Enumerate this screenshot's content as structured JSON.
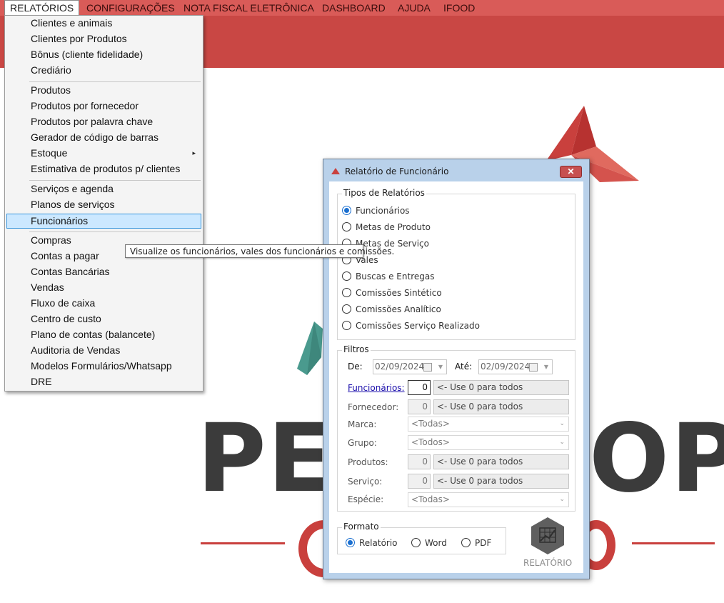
{
  "menubar": {
    "items": [
      "RELATÓRIOS",
      "CONFIGURAÇÕES",
      "NOTA FISCAL ELETRÔNICA",
      "DASHBOARD",
      "AJUDA",
      "IFOOD"
    ]
  },
  "background": {
    "logo_text_left": "PE",
    "logo_text_right": "OP"
  },
  "dropdown": {
    "items": [
      "Clientes e animais",
      "Clientes por Produtos",
      "Bônus (cliente fidelidade)",
      "Crediário",
      "Produtos",
      "Produtos por fornecedor",
      "Produtos por palavra chave",
      "Gerador de código de barras",
      "Estoque",
      "Estimativa de produtos p/ clientes",
      "Serviços e agenda",
      "Planos de serviços",
      "Funcionários",
      "Compras",
      "Contas a pagar",
      "Contas Bancárias",
      "Vendas",
      "Fluxo de caixa",
      "Centro de custo",
      "Plano de contas (balancete)",
      "Auditoria de Vendas",
      "Modelos Formulários/Whatsapp",
      "DRE"
    ],
    "submenu_arrow": "▸",
    "highlighted": "Funcionários"
  },
  "tooltip": {
    "text": "Visualize os funcionários, vales dos funcionários e comissões."
  },
  "dialog": {
    "title": "Relatório de Funcionário",
    "close_label": "✕",
    "tipos": {
      "title": "Tipos de Relatórios",
      "options": [
        "Funcionários",
        "Metas de Produto",
        "Metas de Serviço",
        "Vales",
        "Buscas e Entregas",
        "Comissões Sintético",
        "Comissões Analítico",
        "Comissões Serviço Realizado"
      ],
      "selected": "Funcionários"
    },
    "filtros": {
      "title": "Filtros",
      "de_label": "De:",
      "de_value": "02/09/2024",
      "ate_label": "Até:",
      "ate_value": "02/09/2024",
      "funcionarios_label": "Funcionários:",
      "funcionarios_value": "0",
      "funcionarios_hint": "<- Use 0 para todos",
      "fornecedor_label": "Fornecedor:",
      "fornecedor_value": "0",
      "fornecedor_hint": "<- Use 0 para todos",
      "marca_label": "Marca:",
      "marca_value": "<Todas>",
      "grupo_label": "Grupo:",
      "grupo_value": "<Todos>",
      "produtos_label": "Produtos:",
      "produtos_value": "0",
      "produtos_hint": "<- Use 0 para todos",
      "servico_label": "Serviço:",
      "servico_value": "0",
      "servico_hint": "<- Use 0 para todos",
      "especie_label": "Espécie:",
      "especie_value": "<Todas>"
    },
    "formato": {
      "title": "Formato",
      "options": [
        "Relatório",
        "Word",
        "PDF"
      ],
      "selected": "Relatório"
    },
    "report_button_label": "RELATÓRIO"
  },
  "colors": {
    "menubar": "#d95b58",
    "header": "#c94744",
    "accent_red": "#c9403d",
    "teal": "#4a9a8e",
    "highlight": "#cce8ff"
  }
}
